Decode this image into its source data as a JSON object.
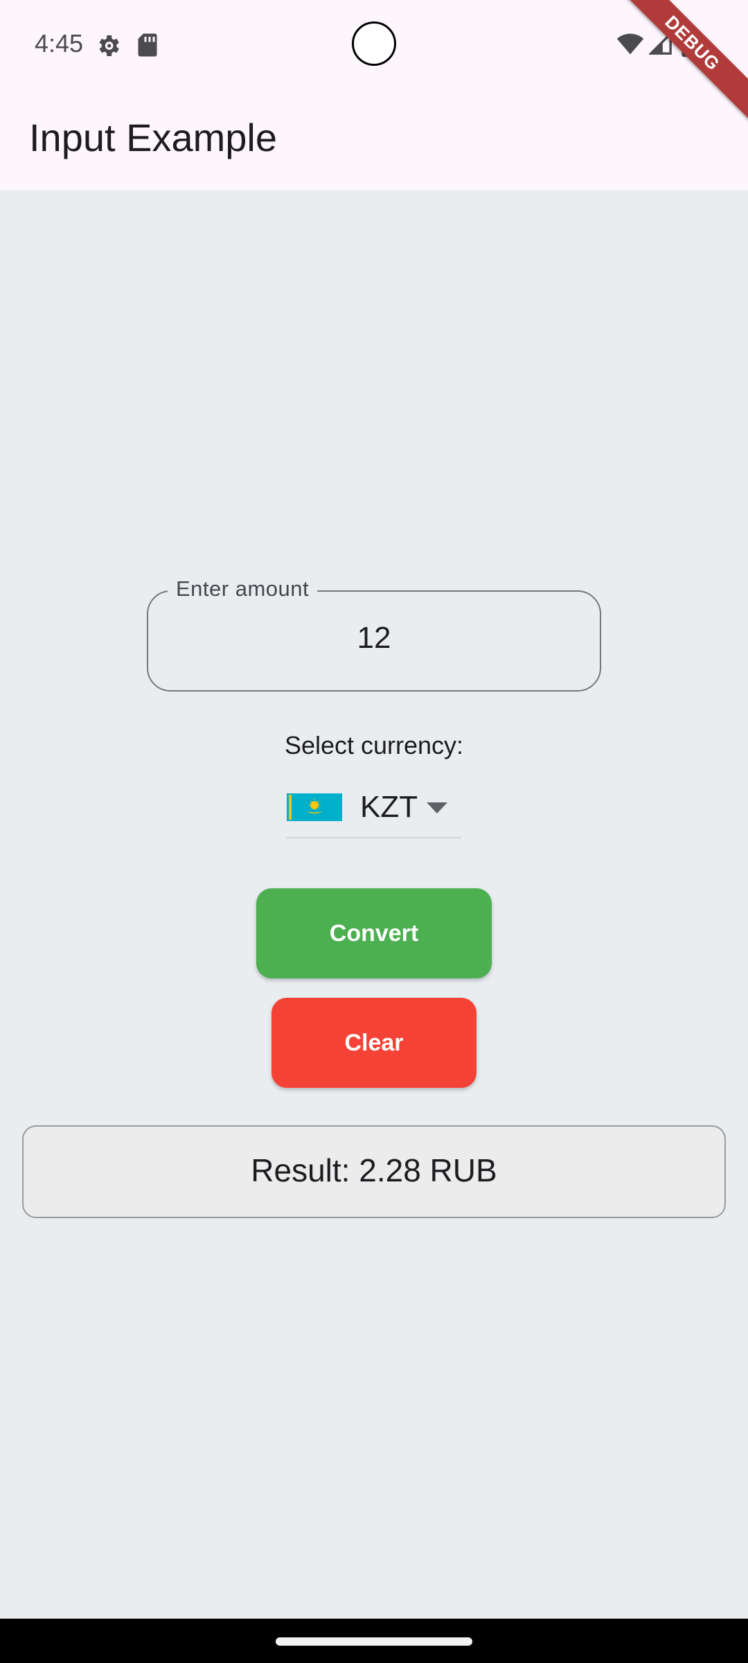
{
  "status_bar": {
    "time": "4:45",
    "icons": [
      "gear-icon",
      "sd-card-icon",
      "wifi-icon",
      "cellular-signal-icon",
      "battery-icon"
    ]
  },
  "debug_banner": "DEBUG",
  "app_bar": {
    "title": "Input Example"
  },
  "form": {
    "amount": {
      "label": "Enter amount",
      "value": "12"
    },
    "currency_caption": "Select currency:",
    "currency": {
      "selected": "KZT",
      "flag_icon": "kazakhstan-flag-icon"
    },
    "convert_label": "Convert",
    "clear_label": "Clear",
    "result_text": "Result: 2.28 RUB"
  },
  "colors": {
    "convert_button": "#4caf50",
    "clear_button": "#f44336",
    "background": "#e9edf0",
    "app_bar": "#fdf6fd",
    "debug_banner": "#b13b3b"
  }
}
